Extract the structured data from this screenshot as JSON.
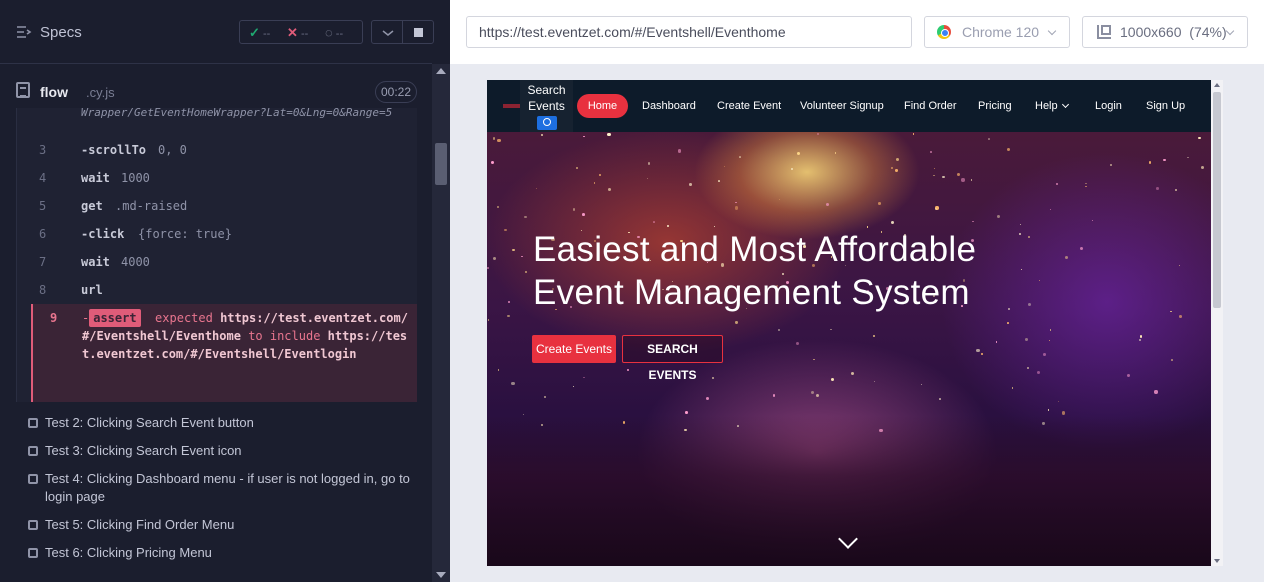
{
  "specs_panel": {
    "title": "Specs",
    "stats": {
      "passed": "--",
      "failed": "--",
      "pending": "--"
    },
    "spec_file": {
      "name": "flow",
      "ext": ".cy.js",
      "duration": "00:22"
    },
    "url_fragment": "Wrapper/GetEventHomeWrapper?Lat=0&Lng=0&Range=5",
    "commands": [
      {
        "num": "3",
        "name": "-scrollTo",
        "arg": "0, 0"
      },
      {
        "num": "4",
        "name": "wait",
        "arg": "1000"
      },
      {
        "num": "5",
        "name": "get",
        "arg": ".md-raised"
      },
      {
        "num": "6",
        "name": "-click",
        "arg": "{force: true}"
      },
      {
        "num": "7",
        "name": "wait",
        "arg": "4000"
      },
      {
        "num": "8",
        "name": "url",
        "arg": ""
      }
    ],
    "assert": {
      "num": "9",
      "prefix": "-",
      "tag": "assert",
      "expected_label": "expected",
      "actual_url": "https://test.eventzet.com/#/Eventshell/Eventhome",
      "include_label": "to include",
      "expected_url": "https://test.eventzet.com/#/Eventshell/Eventlogin"
    },
    "tests": [
      "Test 2: Clicking Search Event button",
      "Test 3: Clicking Search Event icon",
      "Test 4: Clicking Dashboard menu - if user is not logged in, go to login page",
      "Test 5: Clicking Find Order Menu",
      "Test 6: Clicking Pricing Menu"
    ]
  },
  "browser_toolbar": {
    "url": "https://test.eventzet.com/#/Eventshell/Eventhome",
    "browser": "Chrome 120",
    "viewport": "1000x660",
    "zoom": "(74%)"
  },
  "aut": {
    "nav": {
      "search_label_1": "Search",
      "search_label_2": "Events",
      "home": "Home",
      "links": [
        "Dashboard",
        "Create Event",
        "Volunteer Signup",
        "Find Order",
        "Pricing",
        "Help",
        "Login",
        "Sign Up"
      ]
    },
    "hero": {
      "title_line1": "Easiest and Most Affordable",
      "title_line2": "Event Management System",
      "create_btn": "Create Events",
      "search_btn": "SEARCH EVENTS"
    }
  },
  "colors": {
    "accent": "#e8313f",
    "fail": "#e05c79",
    "pass": "#1fa971"
  }
}
